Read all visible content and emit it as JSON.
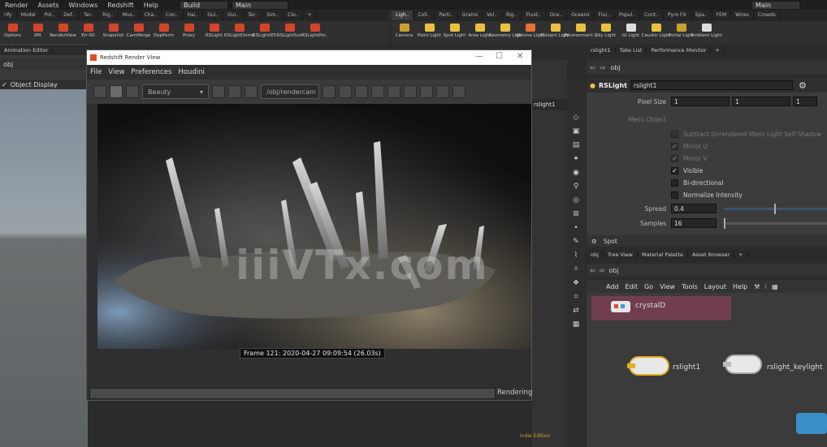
{
  "menubar": {
    "items": [
      "Render",
      "Assets",
      "Windows",
      "Redshift",
      "Help"
    ],
    "desktop": "Build",
    "desktop_right": "Main",
    "desktop_far_right": "Main"
  },
  "shelf_tabs_left": [
    "rify",
    "Model",
    "Pol..",
    "Def..",
    "Ter..",
    "Rig..",
    "Mus..",
    "Cha..",
    "Con..",
    "Hai..",
    "Gui..",
    "Gui..",
    "Ter..",
    "Sim..",
    "Clo.."
  ],
  "shelf_tabs_right": [
    "Ligh..",
    "Coll..",
    "Parti..",
    "Grains",
    "Vol..",
    "Rig..",
    "Fluid..",
    "Oce..",
    "Oceans",
    "Flui..",
    "Popul..",
    "Cont..",
    "Pyro FX",
    "Spa..",
    "FEM",
    "Wires",
    "Crowds"
  ],
  "shelf_tools_left": [
    {
      "label": "Options",
      "color": "#d2452b"
    },
    {
      "label": "IPR",
      "color": "#d2452b"
    },
    {
      "label": "RenderView",
      "color": "#d2452b"
    },
    {
      "label": "Err-00",
      "color": "#d2452b"
    },
    {
      "label": "Snapshot",
      "color": "#d2452b"
    },
    {
      "label": "CamMerge",
      "color": "#d2452b"
    },
    {
      "label": "DopParm",
      "color": "#d2452b"
    },
    {
      "label": "Proxy",
      "color": "#d2452b"
    },
    {
      "label": "RSLight",
      "color": "#d2452b"
    },
    {
      "label": "RSLightDome",
      "color": "#d2452b"
    },
    {
      "label": "RSLightIES",
      "color": "#d2452b"
    },
    {
      "label": "RSLightSun",
      "color": "#d2452b"
    },
    {
      "label": "RSLightPor..",
      "color": "#d2452b"
    }
  ],
  "shelf_tools_right": [
    {
      "label": "Camera",
      "color": "#c8a030"
    },
    {
      "label": "Point Light",
      "color": "#e8c040"
    },
    {
      "label": "Spot Light",
      "color": "#e8c040"
    },
    {
      "label": "Area Light",
      "color": "#e8c040"
    },
    {
      "label": "Geometry Light",
      "color": "#e8c040"
    },
    {
      "label": "Volume Light",
      "color": "#e87030"
    },
    {
      "label": "Distant Light",
      "color": "#e8c040"
    },
    {
      "label": "Environment Light",
      "color": "#e8c040"
    },
    {
      "label": "Sky Light",
      "color": "#e8c040"
    },
    {
      "label": "GI Light",
      "color": "#dddddd"
    },
    {
      "label": "Caustic Light",
      "color": "#e8c040"
    },
    {
      "label": "Portal Light",
      "color": "#c8a030"
    },
    {
      "label": "Ambient Light",
      "color": "#dddddd"
    }
  ],
  "left_panel": {
    "tab": "Animation Editor",
    "path": "obj",
    "display_label": "Object Display"
  },
  "render_view": {
    "title": "Redshift Render View",
    "menu": [
      "File",
      "View",
      "Preferences",
      "Houdini"
    ],
    "aov": "Beauty",
    "camera": "/obj/rendercam",
    "frame_info": "Frame 121: 2020-04-27 09:09:54 (26.03s)",
    "status": "Rendering"
  },
  "right_top_tabs": [
    "rslight1",
    "Take List",
    "Performance Monitor"
  ],
  "param_path": "obj",
  "param": {
    "node_type": "RSLight",
    "node_name": "rslight1",
    "pixel_size_label": "Pixel Size",
    "pixel_size": [
      "1",
      "1",
      "1"
    ],
    "mesh_object_label": "Mesh Object",
    "checkboxes": [
      {
        "label": "Subtract Unrendered Mesh Light Self-Shadow",
        "checked": false,
        "dim": true
      },
      {
        "label": "Mirror U",
        "checked": true,
        "dim": true
      },
      {
        "label": "Mirror V",
        "checked": true,
        "dim": true
      },
      {
        "label": "Visible",
        "checked": true,
        "dim": false
      },
      {
        "label": "Bi-directional",
        "checked": false,
        "dim": false
      },
      {
        "label": "Normalize Intensity",
        "checked": false,
        "dim": false
      }
    ],
    "spread_label": "Spread",
    "spread_value": "0.4",
    "samples_label": "Samples",
    "samples_value": "16",
    "spot_section": "Spot"
  },
  "net_tabs": [
    "obj",
    "Tree View",
    "Material Palette",
    "Asset Browser"
  ],
  "net_path": "obj",
  "net_menu": [
    "Add",
    "Edit",
    "Go",
    "View",
    "Tools",
    "Layout",
    "Help"
  ],
  "nodes": {
    "crystal": "crystalD",
    "light1": "rslight1",
    "light2": "rslight_keylight"
  },
  "edition": "Indie Edition",
  "watermark": "iiiVTx.com"
}
